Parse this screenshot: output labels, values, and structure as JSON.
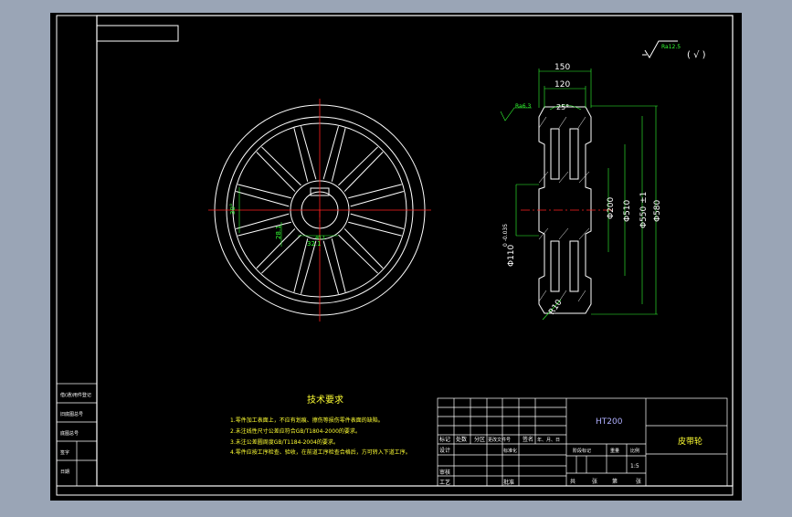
{
  "drawing": {
    "colors": {
      "background": "#000000",
      "outer_bg": "#9aa5b6",
      "frame": "#ffffff",
      "center_line": "#ff2020",
      "dimension": "#33ff33",
      "tech_text": "#ffff33",
      "material": "#b0b0ff"
    },
    "roughness": {
      "general": "Ra12.5",
      "general_suffix": "( √ )",
      "groove": "Ra6.3"
    },
    "dimensions": {
      "width_total": "150",
      "width_groove": "120",
      "groove_angle": "25°",
      "dia_hub": "Φ200",
      "dia_groove_bottom": "Φ510",
      "dia_pitch": "Φ550 ±1",
      "dia_outer": "Φ580",
      "bore": "Φ110",
      "bore_tol": "0 -0.035",
      "fillet": "R10",
      "key_angle": "30°",
      "key_depth": "28.1",
      "key_width": "32.1",
      "key_r": "40.1"
    },
    "tech_requirements": {
      "title": "技术要求",
      "items": [
        "1.零件加工表面上，不应有划痕、擦伤等损伤零件表面的缺陷。",
        "2.未注线性尺寸公差应符合GB/T1804-2000的要求。",
        "3.未注公差圆周度GB/T1184-2004的要求。",
        "4.零件应按工序检查、验收，在前道工序检查合格后，方可转入下道工序。"
      ]
    },
    "left_strip": [
      "借(通)用件登记",
      "旧底图总号",
      "底图总号",
      "签字",
      "日期"
    ],
    "title_block": {
      "material": "HT200",
      "part_name": "皮带轮",
      "scale": "1:5",
      "row_labels": [
        "标记",
        "处数",
        "分区",
        "更改文件号",
        "签名",
        "年、月、日"
      ],
      "design": "设计",
      "standardize": "标准化",
      "stage_mark": "阶段标记",
      "weight": "重量",
      "scale_label": "比例",
      "review": "审核",
      "process": "工艺",
      "approve": "批准",
      "total": "共",
      "sheet": "张",
      "no": "第",
      "zhang": "张"
    }
  }
}
